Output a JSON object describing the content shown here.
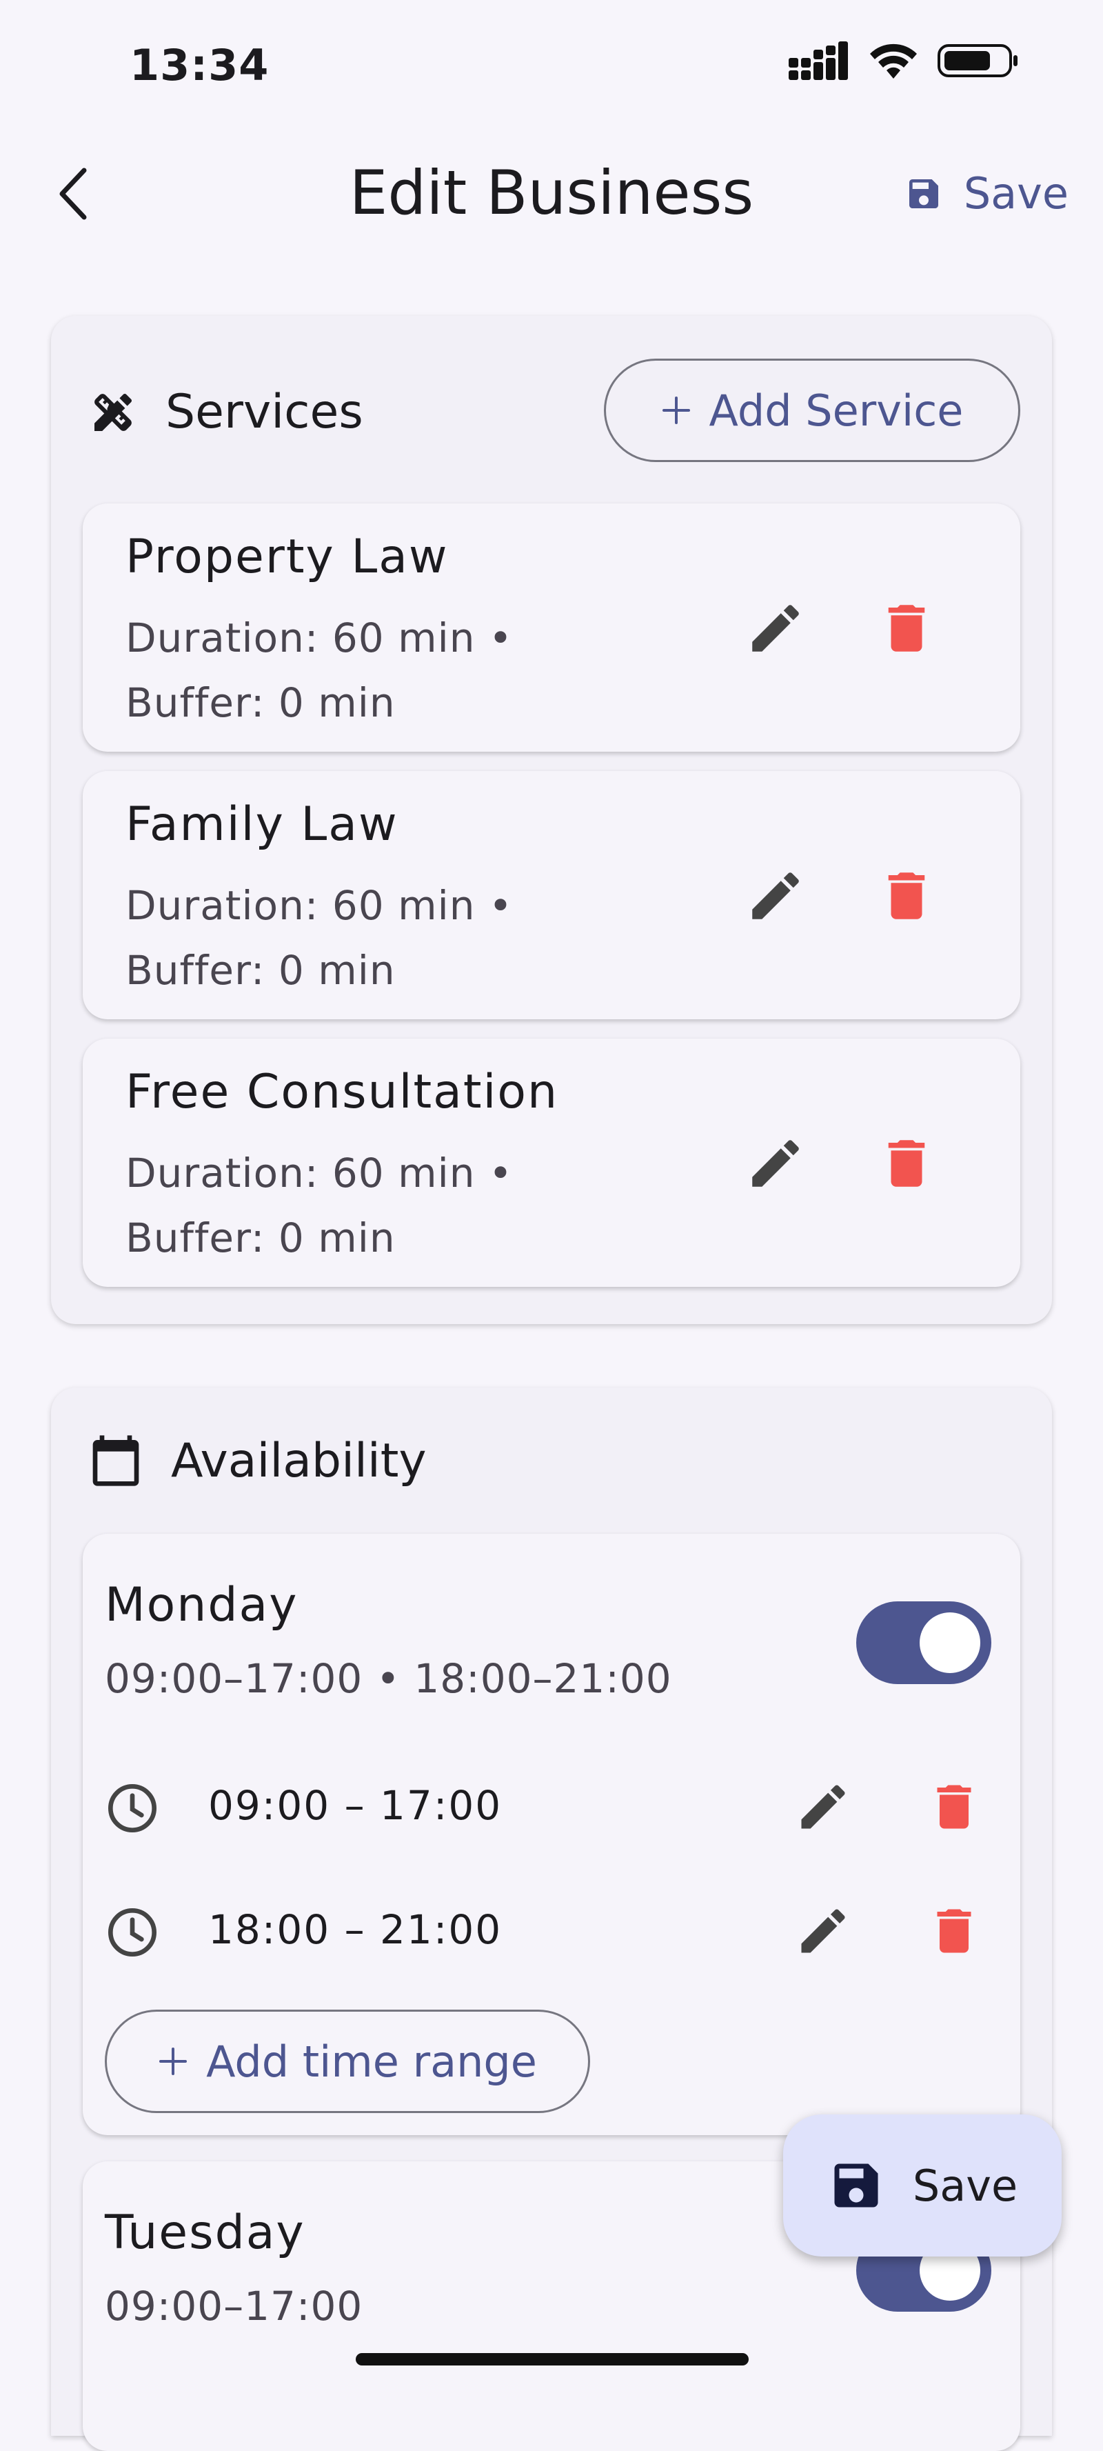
{
  "status_bar": {
    "time": "13:34"
  },
  "app_bar": {
    "title": "Edit Business",
    "save_label": "Save"
  },
  "services": {
    "heading": "Services",
    "add_label": "Add Service",
    "items": [
      {
        "name": "Property Law",
        "duration": "Duration: 60 min •",
        "buffer": "Buffer: 0 min"
      },
      {
        "name": "Family Law",
        "duration": "Duration: 60 min •",
        "buffer": "Buffer: 0 min"
      },
      {
        "name": "Free Consultation",
        "duration": "Duration: 60 min •",
        "buffer": "Buffer: 0 min"
      }
    ]
  },
  "availability": {
    "heading": "Availability",
    "days": [
      {
        "name": "Monday",
        "summary": "09:00–17:00 • 18:00–21:00",
        "enabled": true,
        "ranges": [
          "09:00 – 17:00",
          "18:00 – 21:00"
        ],
        "add_range_label": "Add time range"
      },
      {
        "name": "Tuesday",
        "summary": "09:00–17:00",
        "enabled": true
      }
    ]
  },
  "fab": {
    "label": "Save"
  },
  "colors": {
    "accent": "#4d5690",
    "danger": "#f2544f",
    "fab_bg": "#dfe2fb",
    "surface": "#f2f0f7"
  }
}
